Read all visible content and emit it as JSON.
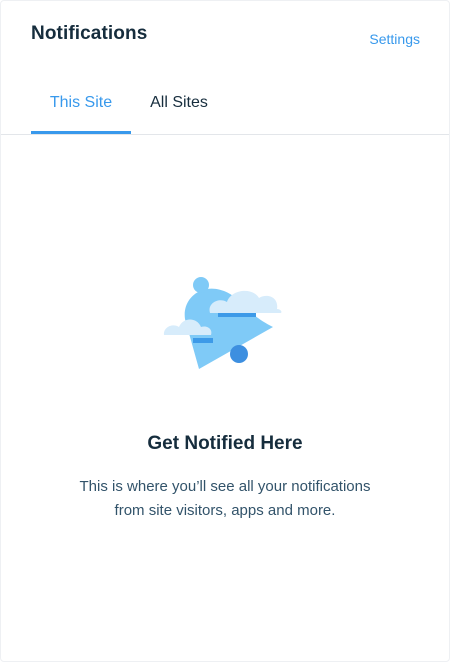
{
  "header": {
    "title": "Notifications",
    "settings_label": "Settings"
  },
  "tabs": [
    {
      "label": "This Site",
      "active": true
    },
    {
      "label": "All Sites",
      "active": false
    }
  ],
  "empty_state": {
    "illustration_icon": "bell-with-clouds-icon",
    "title": "Get Notified Here",
    "description_line1": "This is where you’ll see all your notifications",
    "description_line2": "from site visitors, apps and more."
  },
  "colors": {
    "accent": "#3899ec",
    "title": "#162d3d",
    "body_text": "#32536a",
    "divider": "#e3e6ea"
  }
}
